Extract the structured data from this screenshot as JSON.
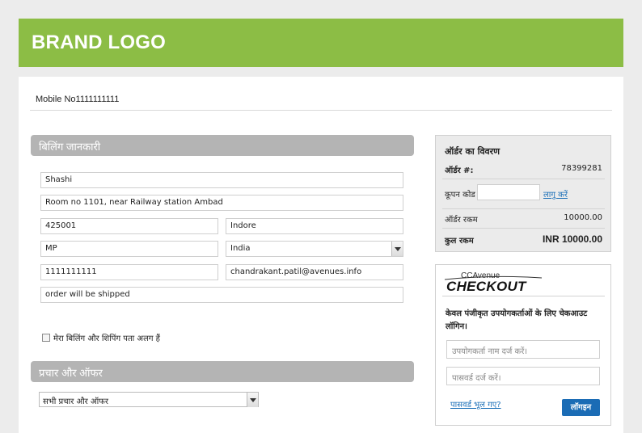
{
  "header": {
    "logo": "BRAND LOGO",
    "color": "#8cbd45"
  },
  "account": {
    "mobile": "Mobile No1111111111"
  },
  "billing": {
    "title": "बिलिंग जानकारी",
    "name": "Shashi",
    "address": "Room no 1101, near Railway station Ambad",
    "zip": "425001",
    "city": "Indore",
    "state": "MP",
    "country": "India",
    "phone": "1111111111",
    "email": "chandrakant.patil@avenues.info",
    "notes": "order will be shipped",
    "different_shipping_label": "मेरा बिलिंग और शिपिंग पता अलग हैं",
    "different_shipping_checked": false
  },
  "promo": {
    "title": "प्रचार और ऑफर",
    "selected": "सभी प्रचार और ऑफर"
  },
  "order": {
    "title": "ऑर्डर का विवरण",
    "order_label": "ऑर्डर #:",
    "order_number": "78399281",
    "coupon_label": "कूपन कोड",
    "coupon_value": "",
    "coupon_apply": "लागु करें",
    "amount_label": "ऑर्डर रकम",
    "amount": "10000.00",
    "total_label": "कुल रकम",
    "total": "INR 10000.00"
  },
  "login": {
    "brand_top": "CCAvenue",
    "brand_bottom": "CHECKOUT",
    "note": "केवल पंजीकृत उपयोगकर्ताओं के लिए चेकआउट लॉगिन।",
    "username_placeholder": "उपयोगकर्ता नाम दर्ज करें।",
    "password_placeholder": "पासवर्ड दर्ज करें।",
    "forgot": "पासवर्ड भूल गए?",
    "button": "लॉगइन",
    "button_color": "#1b6cb5"
  }
}
